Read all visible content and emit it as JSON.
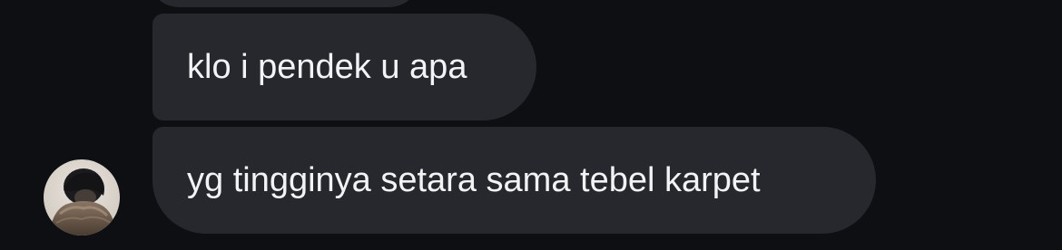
{
  "messages": [
    {
      "text": "klo i pendek u apa"
    },
    {
      "text": "yg tingginya setara sama tebel karpet"
    }
  ],
  "sender": {
    "avatar_icon": "profile-photo"
  },
  "colors": {
    "background": "#0d0f13",
    "bubble": "#26282d",
    "text": "#f2f3f5"
  }
}
